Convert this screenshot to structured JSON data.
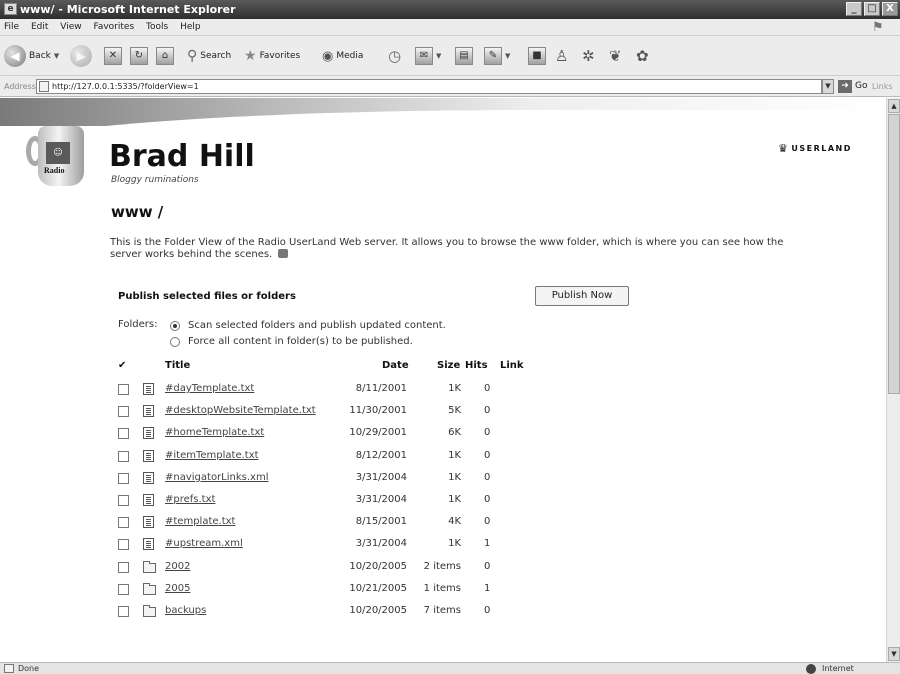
{
  "window": {
    "title": "www/ - Microsoft Internet Explorer",
    "controls": [
      "_",
      "□",
      "X"
    ]
  },
  "menu": [
    "File",
    "Edit",
    "View",
    "Favorites",
    "Tools",
    "Help"
  ],
  "toolbar": {
    "back": "Back",
    "search": "Search",
    "favorites": "Favorites",
    "media": "Media"
  },
  "address": {
    "label": "Address",
    "url": "http://127.0.0.1:5335/?folderView=1",
    "go": "Go",
    "links": "Links"
  },
  "status": {
    "left": "Done",
    "right": "Internet"
  },
  "site": {
    "title": "Brad Hill",
    "subtitle": "Bloggy ruminations",
    "mug_text": "Radio",
    "brand": "USERLAND"
  },
  "page": {
    "heading": "www /",
    "intro": "This is the Folder View of the Radio UserLand Web server. It allows you to browse the www folder, which is where you can see how the server works behind the scenes."
  },
  "publish": {
    "heading": "Publish selected files or folders",
    "button": "Publish Now",
    "folders_label": "Folders:",
    "options": [
      {
        "label": "Scan selected folders and publish updated content.",
        "selected": true
      },
      {
        "label": "Force all content in folder(s) to be published.",
        "selected": false
      }
    ]
  },
  "table": {
    "headers": {
      "check": "✔",
      "title": "Title",
      "date": "Date",
      "size": "Size",
      "hits": "Hits",
      "link": "Link"
    },
    "rows": [
      {
        "type": "file",
        "title": "#dayTemplate.txt",
        "date": "8/11/2001",
        "size": "1K",
        "hits": "0"
      },
      {
        "type": "file",
        "title": "#desktopWebsiteTemplate.txt",
        "date": "11/30/2001",
        "size": "5K",
        "hits": "0"
      },
      {
        "type": "file",
        "title": "#homeTemplate.txt",
        "date": "10/29/2001",
        "size": "6K",
        "hits": "0"
      },
      {
        "type": "file",
        "title": "#itemTemplate.txt",
        "date": "8/12/2001",
        "size": "1K",
        "hits": "0"
      },
      {
        "type": "file",
        "title": "#navigatorLinks.xml",
        "date": "3/31/2004",
        "size": "1K",
        "hits": "0"
      },
      {
        "type": "file",
        "title": "#prefs.txt",
        "date": "3/31/2004",
        "size": "1K",
        "hits": "0"
      },
      {
        "type": "file",
        "title": "#template.txt",
        "date": "8/15/2001",
        "size": "4K",
        "hits": "0"
      },
      {
        "type": "file",
        "title": "#upstream.xml",
        "date": "3/31/2004",
        "size": "1K",
        "hits": "1"
      },
      {
        "type": "folder",
        "title": "2002",
        "date": "10/20/2005",
        "size": "2 items",
        "hits": "0"
      },
      {
        "type": "folder",
        "title": "2005",
        "date": "10/21/2005",
        "size": "1 items",
        "hits": "1"
      },
      {
        "type": "folder",
        "title": "backups",
        "date": "10/20/2005",
        "size": "7 items",
        "hits": "0"
      }
    ]
  }
}
